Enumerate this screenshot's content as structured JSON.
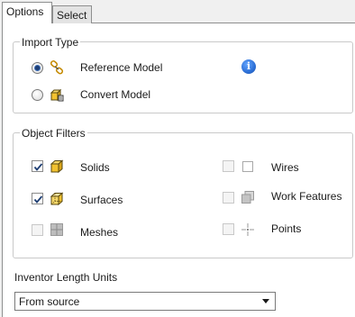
{
  "tabs": [
    {
      "label": "Options",
      "active": true
    },
    {
      "label": "Select",
      "active": false
    }
  ],
  "import_type": {
    "legend": "Import Type",
    "options": [
      {
        "label": "Reference Model",
        "checked": true,
        "icon": "link-icon"
      },
      {
        "label": "Convert Model",
        "checked": false,
        "icon": "convert-model-icon"
      }
    ],
    "info_icon": "info-icon",
    "info_glyph": "i"
  },
  "object_filters": {
    "legend": "Object Filters",
    "left": [
      {
        "label": "Solids",
        "checked": true,
        "enabled": true,
        "icon": "solid-cube-icon"
      },
      {
        "label": "Surfaces",
        "checked": true,
        "enabled": true,
        "icon": "surface-cube-icon"
      },
      {
        "label": "Meshes",
        "checked": false,
        "enabled": false,
        "icon": "mesh-icon"
      }
    ],
    "right": [
      {
        "label": "Wires",
        "checked": false,
        "enabled": false,
        "icon": "wire-icon"
      },
      {
        "label": "Work Features",
        "checked": false,
        "enabled": false,
        "icon": "work-features-icon"
      },
      {
        "label": "Points",
        "checked": false,
        "enabled": false,
        "icon": "point-icon"
      }
    ]
  },
  "units": {
    "label": "Inventor Length Units",
    "selected": "From source"
  },
  "colors": {
    "accent_blue": "#2c6fd6",
    "cube_yellow": "#f2c230",
    "radio_dot": "#1e3e73"
  }
}
